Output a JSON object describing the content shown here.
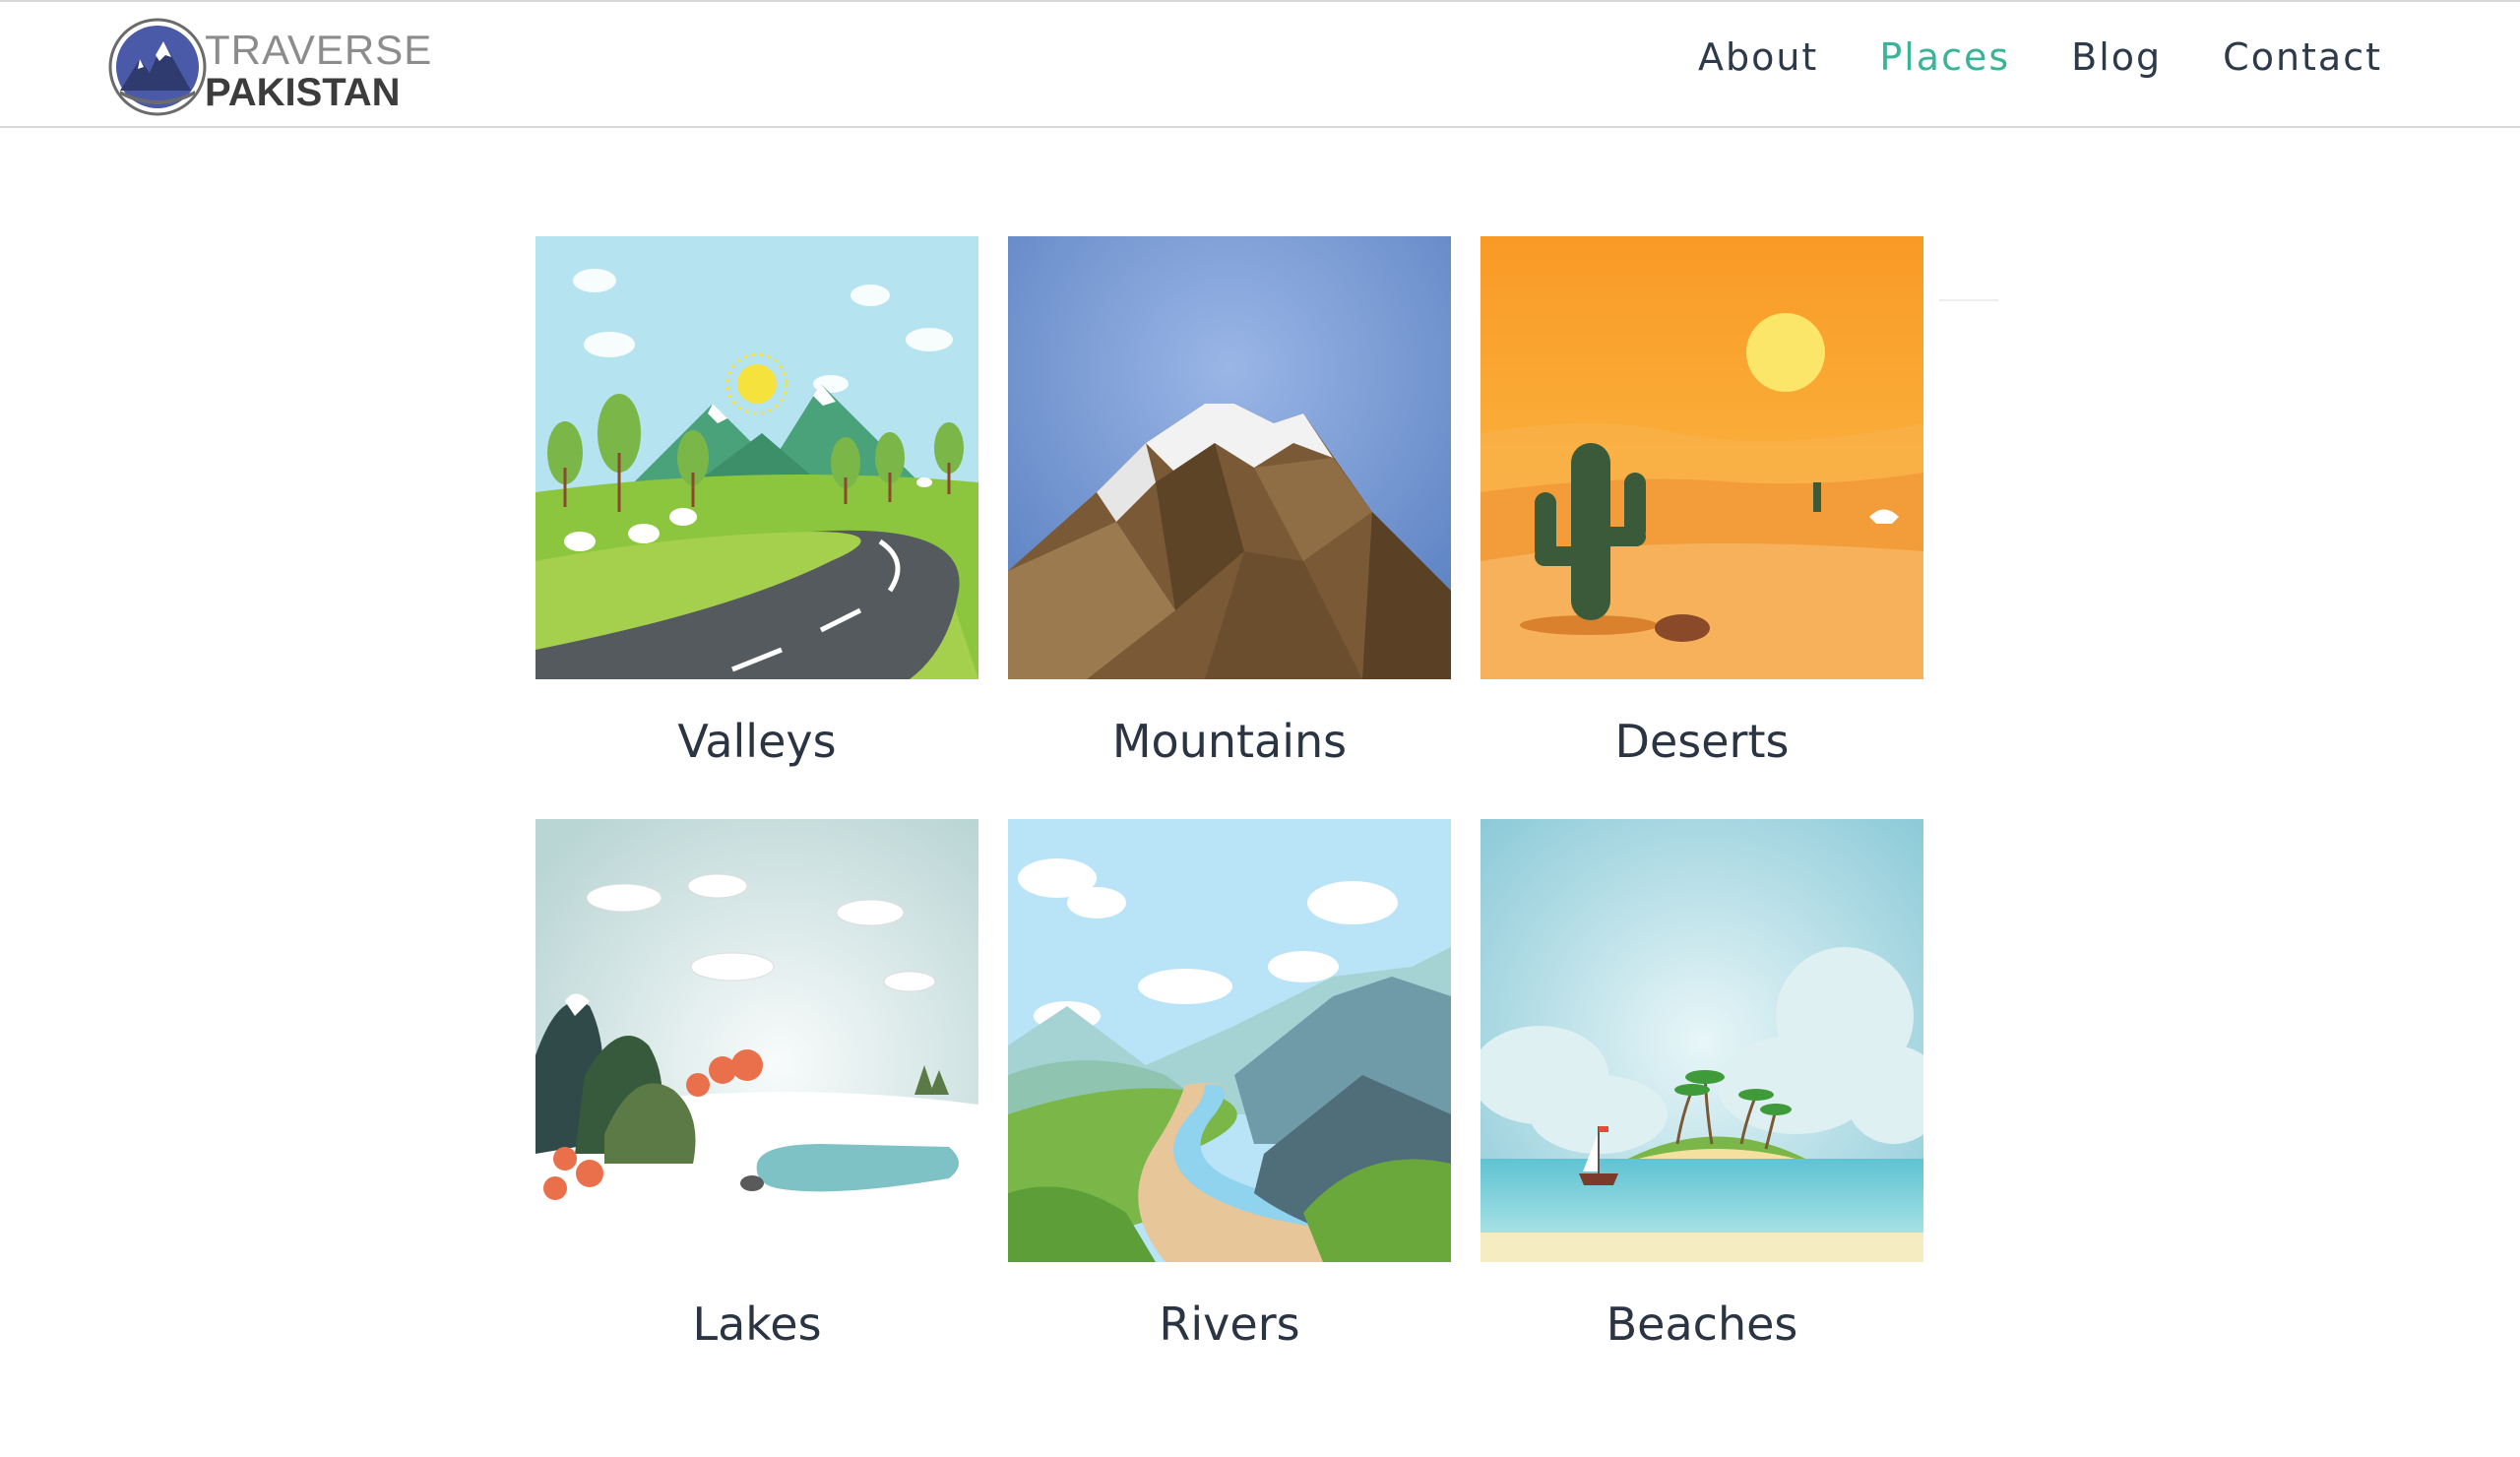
{
  "brand": {
    "line1": "TRAVERSE",
    "line2": "PAKISTAN",
    "accent_color": "#3bb399"
  },
  "nav": {
    "items": [
      {
        "label": "About",
        "active": false
      },
      {
        "label": "Places",
        "active": true
      },
      {
        "label": "Blog",
        "active": false
      },
      {
        "label": "Contact",
        "active": false
      }
    ]
  },
  "places": [
    {
      "label": "Valleys",
      "illustration": "valley-road-illustration"
    },
    {
      "label": "Mountains",
      "illustration": "mountain-peak-illustration"
    },
    {
      "label": "Deserts",
      "illustration": "desert-cactus-illustration"
    },
    {
      "label": "Lakes",
      "illustration": "snowy-lake-illustration"
    },
    {
      "label": "Rivers",
      "illustration": "river-valley-illustration"
    },
    {
      "label": "Beaches",
      "illustration": "island-beach-illustration"
    }
  ]
}
